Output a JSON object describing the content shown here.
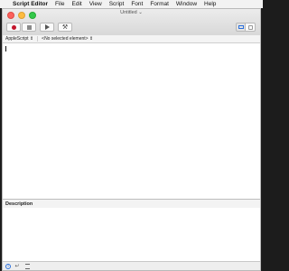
{
  "menubar": {
    "app_name": "Script Editor",
    "items": [
      {
        "label": "File"
      },
      {
        "label": "Edit"
      },
      {
        "label": "View"
      },
      {
        "label": "Script"
      },
      {
        "label": "Font"
      },
      {
        "label": "Format"
      },
      {
        "label": "Window"
      },
      {
        "label": "Help"
      }
    ]
  },
  "window": {
    "title": "Untitled",
    "title_suffix": "⌄"
  },
  "toolbar": {
    "record_icon": "record-icon",
    "stop_icon": "stop-icon",
    "run_icon": "play-icon",
    "compile_icon": "hammer-icon"
  },
  "navbar": {
    "language": "AppleScript ⇕",
    "element": "<No selected element> ⇕"
  },
  "description": {
    "header": "Description"
  },
  "bottombar": {
    "info_glyph": "i",
    "reply_glyph": "↵"
  },
  "colors": {
    "record": "#c3162c",
    "accent": "#2a6fdc"
  }
}
